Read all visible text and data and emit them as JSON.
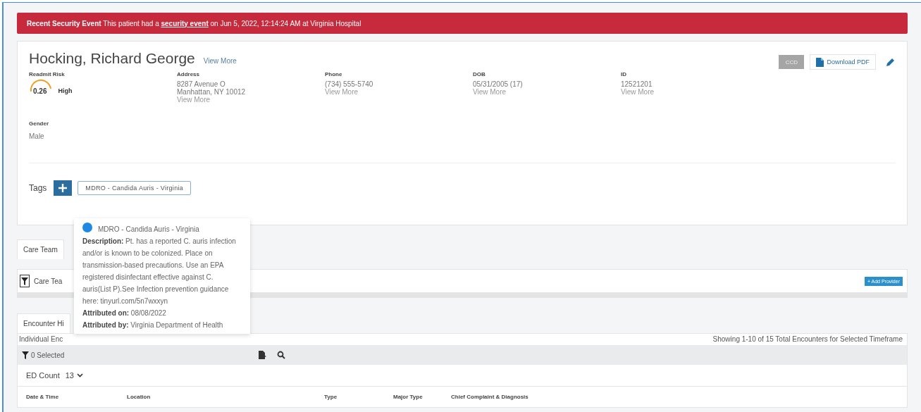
{
  "banner": {
    "label": "Recent Security Event",
    "before": "This patient had a",
    "link": "security event",
    "after": "on Jun 5, 2022, 12:14:24 AM at Virginia Hospital"
  },
  "patient": {
    "name": "Hocking, Richard George",
    "view_more": "View More",
    "ccd_button": "CCD",
    "download_button": "Download PDF",
    "readmit": {
      "label": "Readmit Risk",
      "score": "0.26",
      "rating": "High"
    },
    "fields": [
      {
        "label": "Address",
        "lines": [
          "8287 Avenue O",
          "Manhattan, NY 10012"
        ],
        "link": "View More"
      },
      {
        "label": "Phone",
        "lines": [
          "(734) 555-5740"
        ],
        "link": "View More"
      },
      {
        "label": "DOB",
        "lines": [
          "05/31/2005 (17)"
        ],
        "link": "View More"
      },
      {
        "label": "ID",
        "lines": [
          "12521201"
        ],
        "link": "View More"
      }
    ],
    "gender": {
      "label": "Gender",
      "value": "Male"
    },
    "tags": {
      "label": "Tags",
      "items": [
        "MDRO - Candida Auris - Virginia"
      ]
    }
  },
  "tooltip": {
    "title": "MDRO - Candida Auris - Virginia",
    "lines": [
      {
        "label": "Description:",
        "text": "Pt. has a reported C. auris infection and/or is known to be colonized. Place on transmission-based precautions. Use an EPA registered disinfectant effective against C. auris(List P).See Infection prevention guidance here: tinyurl.com/5n7wxxyn"
      },
      {
        "label": "Attributed on:",
        "text": "08/08/2022"
      },
      {
        "label": "Attributed by:",
        "text": "Virginia Department of Health"
      }
    ]
  },
  "care_team": {
    "tab": "Care Team",
    "filter_label": "Care Tea",
    "add_button": "+ Add Provider"
  },
  "encounters": {
    "tab": "Encounter Hi",
    "subtitle": "Individual Enc",
    "summary": "Showing 1-10 of 15 Total Encounters for Selected Timeframe",
    "filter": "0 Selected",
    "ed_count_label": "ED Count",
    "ed_count": "13",
    "columns": [
      "Date & Time",
      "Location",
      "Type",
      "Major Type",
      "Chief Complaint & Diagnosis"
    ]
  }
}
